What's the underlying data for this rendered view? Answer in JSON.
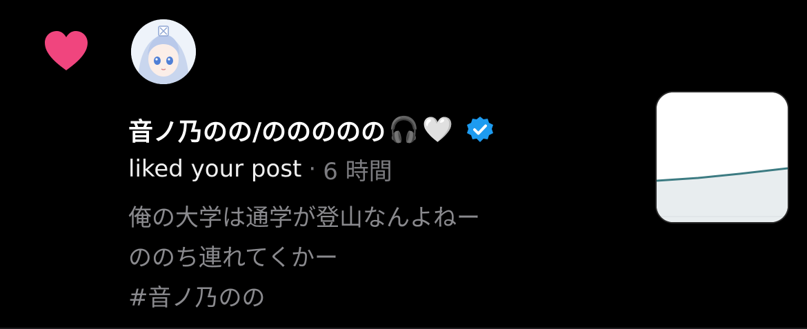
{
  "notification": {
    "type_icon": "heart-icon",
    "user": {
      "display_name": "音ノ乃のの/ののののの",
      "emoji_1": "🎧",
      "emoji_2": "🤍",
      "verified_icon": "verified-badge-icon",
      "avatar_icon": "avatar"
    },
    "action": "liked your post",
    "separator": "·",
    "timestamp": "6 時間",
    "post_text_lines": [
      "俺の大学は通学が登山なんよねー",
      "ののち連れてくかー",
      "#音ノ乃のの"
    ],
    "thumbnail_icon": "post-thumbnail"
  },
  "colors": {
    "background": "#000000",
    "heart": "#f0457e",
    "verified": "#1d9bf0",
    "primary_text": "#ffffff",
    "secondary_text": "#7c7c80",
    "chart_line": "#3c7b82"
  }
}
